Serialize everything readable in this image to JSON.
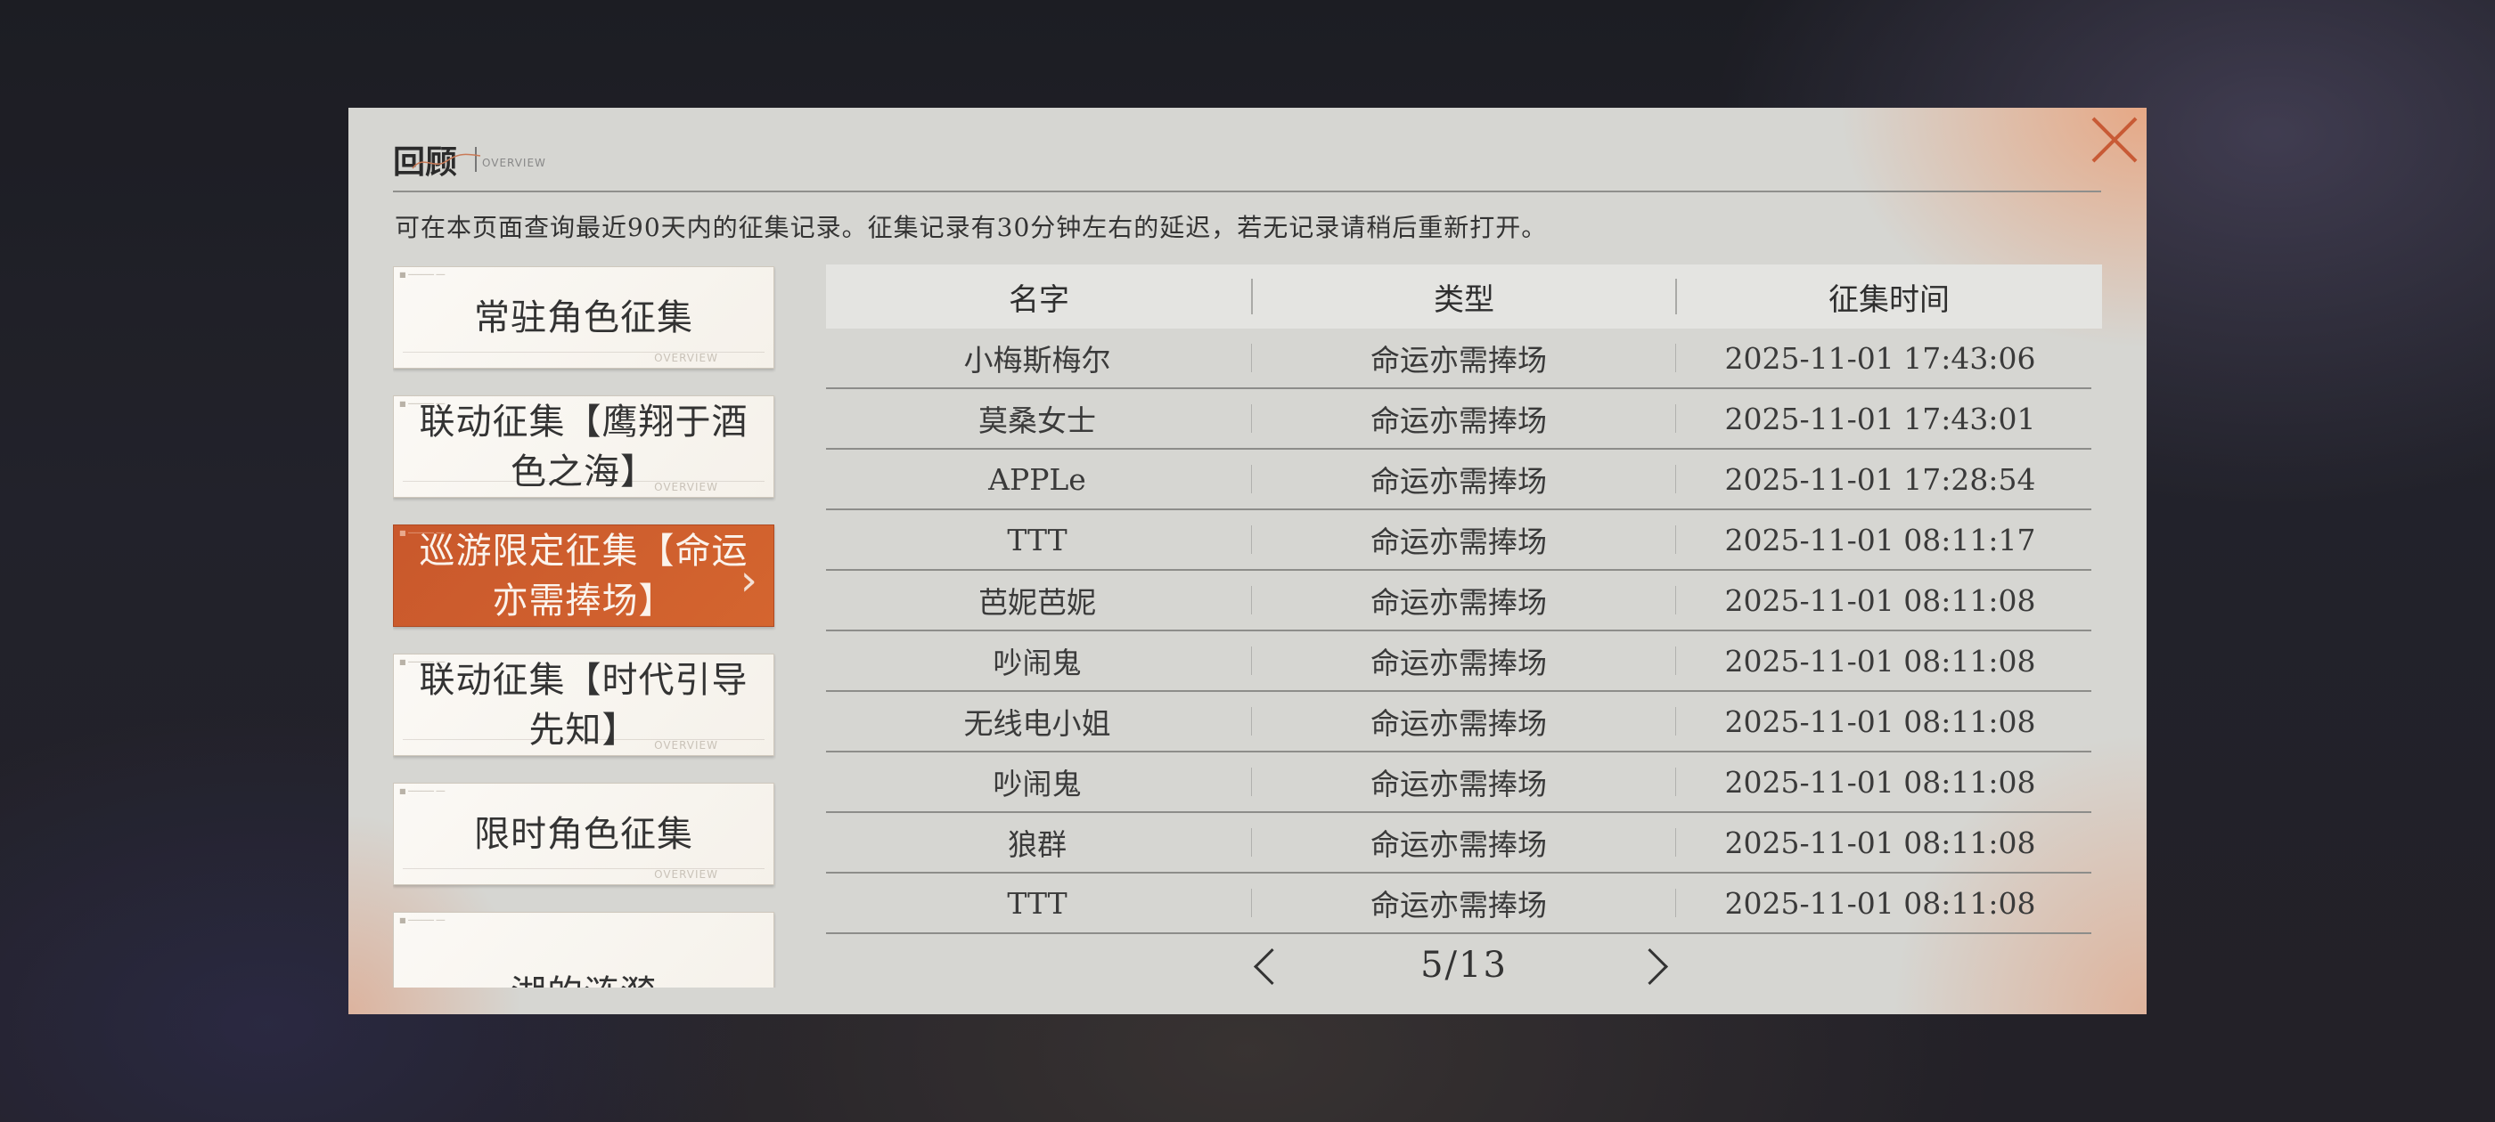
{
  "header": {
    "title": "回顾",
    "subtitle": "OVERVIEW",
    "notice": "可在本页面查询最近90天内的征集记录。征集记录有30分钟左右的延迟，若无记录请稍后重新打开。"
  },
  "sidebar": {
    "items": [
      {
        "label": "常驻角色征集",
        "active": false
      },
      {
        "label": "联动征集【鹰翔于酒色之海】",
        "active": false
      },
      {
        "label": "巡游限定征集【命运亦需捧场】",
        "active": true
      },
      {
        "label": "联动征集【时代引导先知】",
        "active": false
      },
      {
        "label": "限时角色征集",
        "active": false
      },
      {
        "label": "湖的涟漪",
        "active": false
      }
    ],
    "item_subtitle": "OVERVIEW"
  },
  "table": {
    "columns": [
      "名字",
      "类型",
      "征集时间"
    ],
    "rows": [
      {
        "name": "小梅斯梅尔",
        "type": "命运亦需捧场",
        "time": "2025-11-01 17:43:06"
      },
      {
        "name": "莫桑女士",
        "type": "命运亦需捧场",
        "time": "2025-11-01 17:43:01"
      },
      {
        "name": "APPLe",
        "type": "命运亦需捧场",
        "time": "2025-11-01 17:28:54"
      },
      {
        "name": "TTT",
        "type": "命运亦需捧场",
        "time": "2025-11-01 08:11:17"
      },
      {
        "name": "芭妮芭妮",
        "type": "命运亦需捧场",
        "time": "2025-11-01 08:11:08"
      },
      {
        "name": "吵闹鬼",
        "type": "命运亦需捧场",
        "time": "2025-11-01 08:11:08"
      },
      {
        "name": "无线电小姐",
        "type": "命运亦需捧场",
        "time": "2025-11-01 08:11:08"
      },
      {
        "name": "吵闹鬼",
        "type": "命运亦需捧场",
        "time": "2025-11-01 08:11:08"
      },
      {
        "name": "狼群",
        "type": "命运亦需捧场",
        "time": "2025-11-01 08:11:08"
      },
      {
        "name": "TTT",
        "type": "命运亦需捧场",
        "time": "2025-11-01 08:11:08"
      }
    ]
  },
  "pager": {
    "page": "5/13"
  },
  "icons": {
    "close": "close-icon",
    "prev": "chevron-left-icon",
    "next": "chevron-right-icon",
    "active_marker": "chevron-right-icon"
  },
  "colors": {
    "accent": "#c9582c",
    "panel": "#d6d6d2"
  }
}
